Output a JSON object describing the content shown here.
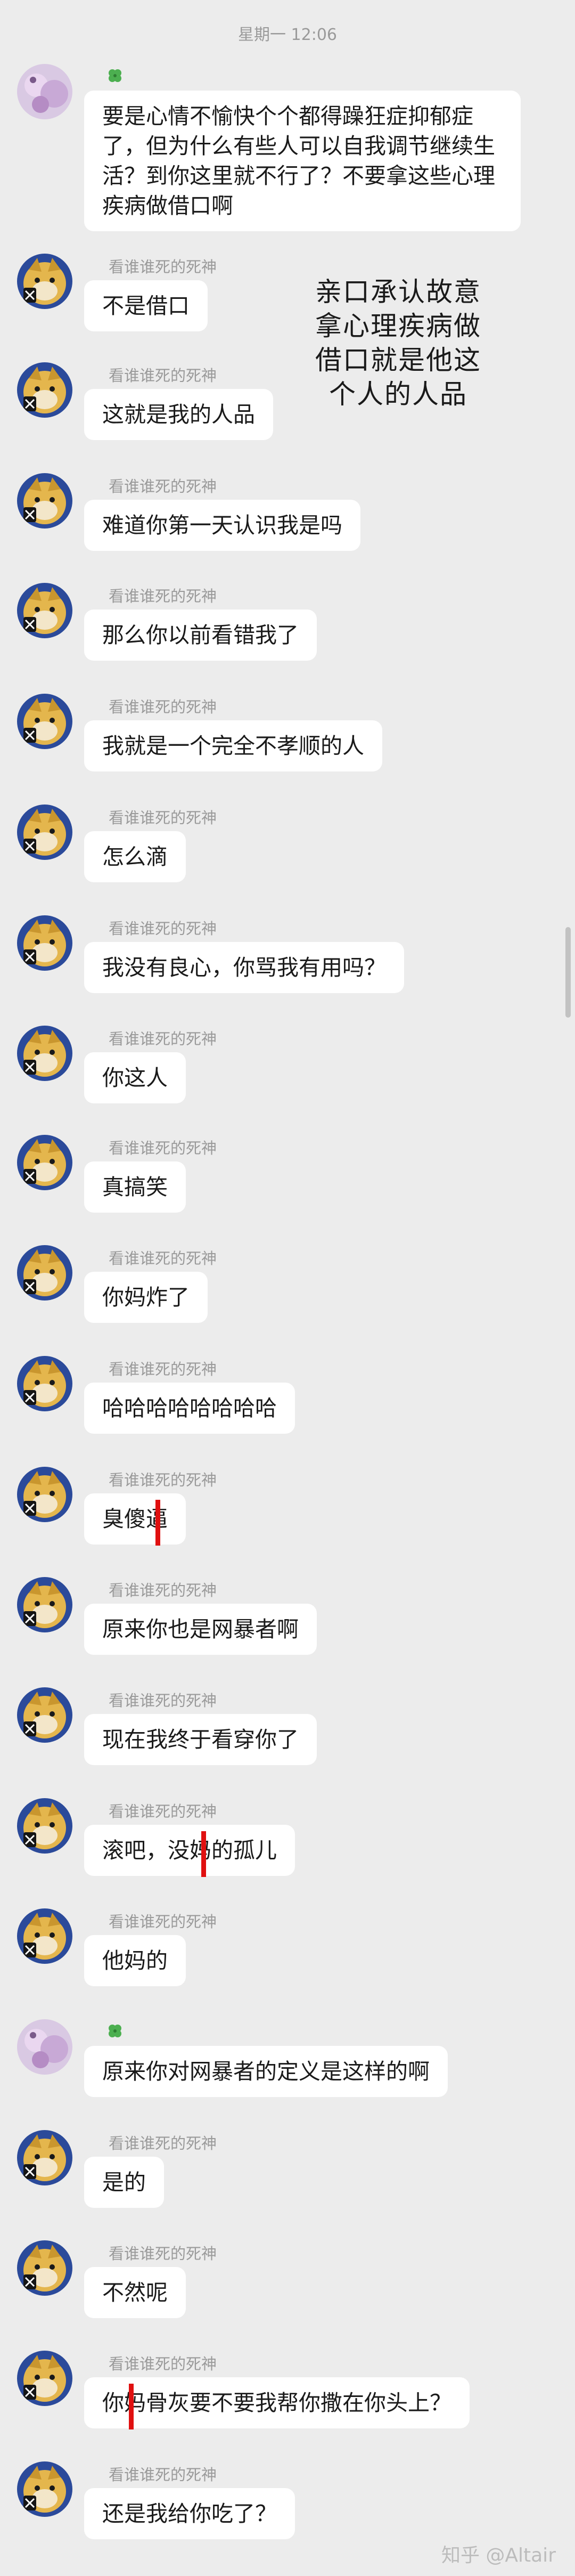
{
  "header": {
    "timestamp": "星期一 12:06"
  },
  "annotation_lines": [
    "亲口承认故意",
    "拿心理疾病做",
    "借口就是他这",
    "个人的人品"
  ],
  "watermark": "知乎 @Altair",
  "colors": {
    "background": "#ececec",
    "bubble": "#ffffff",
    "text": "#1a1a1a",
    "name": "#9a9a9a",
    "mark": "#e01010"
  },
  "messages": [
    {
      "sender": "",
      "sender_icon": "clover-icon",
      "text": "要是心情不愉快个个都得躁狂症抑郁症了，但为什么有些人可以自我调节继续生活？到你这里就不行了？不要拿这些心理疾病做借口啊"
    },
    {
      "sender": "看谁谁死的死神",
      "text": "不是借口"
    },
    {
      "sender": "看谁谁死的死神",
      "text": "这就是我的人品"
    },
    {
      "sender": "看谁谁死的死神",
      "text": "难道你第一天认识我是吗"
    },
    {
      "sender": "看谁谁死的死神",
      "text": "那么你以前看错我了"
    },
    {
      "sender": "看谁谁死的死神",
      "text": "我就是一个完全不孝顺的人"
    },
    {
      "sender": "看谁谁死的死神",
      "text": "怎么滴"
    },
    {
      "sender": "看谁谁死的死神",
      "text": "我没有良心，你骂我有用吗？"
    },
    {
      "sender": "看谁谁死的死神",
      "text": "你这人"
    },
    {
      "sender": "看谁谁死的死神",
      "text": "真搞笑"
    },
    {
      "sender": "看谁谁死的死神",
      "text": "你妈炸了"
    },
    {
      "sender": "看谁谁死的死神",
      "text": "哈哈哈哈哈哈哈哈"
    },
    {
      "sender": "看谁谁死的死神",
      "text": "臭傻逼"
    },
    {
      "sender": "看谁谁死的死神",
      "text": "原来你也是网暴者啊"
    },
    {
      "sender": "看谁谁死的死神",
      "text": "现在我终于看穿你了"
    },
    {
      "sender": "看谁谁死的死神",
      "text": "滚吧，没妈的孤儿"
    },
    {
      "sender": "看谁谁死的死神",
      "text": "他妈的"
    },
    {
      "sender": "",
      "sender_icon": "clover-icon",
      "text": "原来你对网暴者的定义是这样的啊"
    },
    {
      "sender": "看谁谁死的死神",
      "text": "是的"
    },
    {
      "sender": "看谁谁死的死神",
      "text": "不然呢"
    },
    {
      "sender": "看谁谁死的死神",
      "text": "你妈骨灰要不要我帮你撒在你头上？"
    },
    {
      "sender": "看谁谁死的死神",
      "text": "还是我给你吃了？"
    }
  ]
}
